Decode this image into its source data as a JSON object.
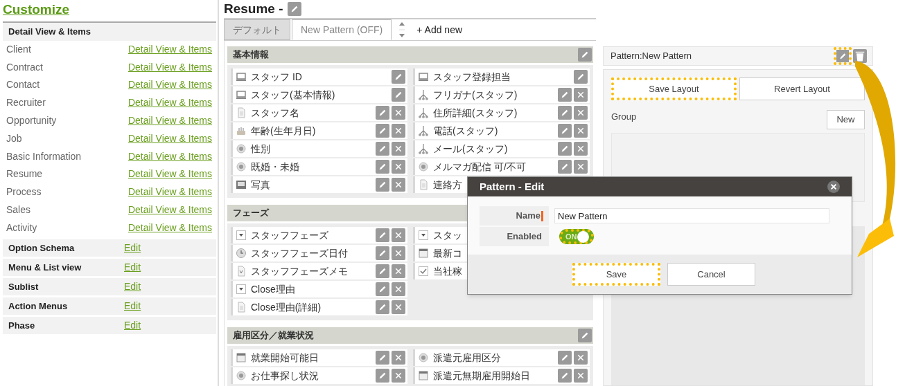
{
  "sidebar": {
    "title": "Customize",
    "header": "Detail View & Items",
    "items": [
      {
        "label": "Client",
        "link": "Detail View & Items"
      },
      {
        "label": "Contract",
        "link": "Detail View & Items"
      },
      {
        "label": "Contact",
        "link": "Detail View & Items"
      },
      {
        "label": "Recruiter",
        "link": "Detail View & Items"
      },
      {
        "label": "Opportunity",
        "link": "Detail View & Items"
      },
      {
        "label": "Job",
        "link": "Detail View & Items"
      },
      {
        "label": "Basic Information",
        "link": "Detail View & Items"
      },
      {
        "label": "Resume",
        "link": "Detail View & Items"
      },
      {
        "label": "Process",
        "link": "Detail View & Items"
      },
      {
        "label": "Sales",
        "link": "Detail View & Items"
      },
      {
        "label": "Activity",
        "link": "Detail View & Items"
      }
    ],
    "sections": [
      {
        "label": "Option Schema",
        "link": "Edit"
      },
      {
        "label": "Menu & List view",
        "link": "Edit"
      },
      {
        "label": "Sublist",
        "link": "Edit"
      },
      {
        "label": "Action Menus",
        "link": "Edit"
      },
      {
        "label": "Phase",
        "link": "Edit"
      }
    ]
  },
  "page": {
    "title": "Resume -"
  },
  "tabs": [
    {
      "label": "デフォルト",
      "selected": false
    },
    {
      "label": "New Pattern (OFF)",
      "selected": true
    }
  ],
  "add_new": "+ Add new",
  "sections": [
    {
      "title": "基本情報",
      "edit": true,
      "columns": [
        [
          {
            "kind": "monitor",
            "label": "スタッフ ID",
            "edit": true,
            "delete": false
          },
          {
            "kind": "monitor",
            "label": "スタッフ(基本情報)",
            "edit": true,
            "delete": false
          },
          {
            "kind": "doc",
            "label": "スタッフ名",
            "edit": true,
            "delete": true
          },
          {
            "kind": "cake",
            "label": "年齢(生年月日)",
            "edit": true,
            "delete": true
          },
          {
            "kind": "radio",
            "label": "性別",
            "edit": true,
            "delete": true
          },
          {
            "kind": "radio",
            "label": "既婚・未婚",
            "edit": true,
            "delete": true
          },
          {
            "kind": "photo",
            "label": "写真",
            "edit": true,
            "delete": true
          }
        ],
        [
          {
            "kind": "monitor",
            "label": "スタッフ登録担当",
            "edit": true,
            "delete": false
          },
          {
            "kind": "tree",
            "label": "フリガナ(スタッフ)",
            "edit": true,
            "delete": true
          },
          {
            "kind": "tree",
            "label": "住所詳細(スタッフ)",
            "edit": true,
            "delete": true
          },
          {
            "kind": "tree",
            "label": "電話(スタッフ)",
            "edit": true,
            "delete": true
          },
          {
            "kind": "tree",
            "label": "メール(スタッフ)",
            "edit": true,
            "delete": true
          },
          {
            "kind": "radio",
            "label": "メルマガ配信 可/不可",
            "edit": true,
            "delete": true
          },
          {
            "kind": "doc",
            "label": "連絡方",
            "edit": false,
            "delete": false
          }
        ]
      ]
    },
    {
      "title": "フェーズ",
      "edit": false,
      "columns": [
        [
          {
            "kind": "dropdown",
            "label": "スタッフフェーズ",
            "edit": true,
            "delete": true
          },
          {
            "kind": "clock",
            "label": "スタッフフェーズ日付",
            "edit": true,
            "delete": true
          },
          {
            "kind": "memo",
            "label": "スタッフフェーズメモ",
            "edit": true,
            "delete": true
          },
          {
            "kind": "dropdown",
            "label": "Close理由",
            "edit": true,
            "delete": true
          },
          {
            "kind": "doc",
            "label": "Close理由(詳細)",
            "edit": true,
            "delete": true
          }
        ],
        [
          {
            "kind": "dropdown",
            "label": "スタッ",
            "edit": false,
            "delete": false
          },
          {
            "kind": "calendar",
            "label": "最新コ",
            "edit": false,
            "delete": false
          },
          {
            "kind": "check",
            "label": "当社稼",
            "edit": false,
            "delete": false
          }
        ]
      ]
    },
    {
      "title": "雇用区分／就業状況",
      "edit": true,
      "columns": [
        [
          {
            "kind": "calendar",
            "label": "就業開始可能日",
            "edit": true,
            "delete": true
          },
          {
            "kind": "radio",
            "label": "お仕事探し状況",
            "edit": true,
            "delete": true
          }
        ],
        [
          {
            "kind": "radio",
            "label": "派遣元雇用区分",
            "edit": true,
            "delete": true
          },
          {
            "kind": "calendar",
            "label": "派遣元無期雇用開始日",
            "edit": true,
            "delete": true
          }
        ]
      ]
    }
  ],
  "pattern_panel": {
    "title": "Pattern:New Pattern",
    "edit_highlighted": true,
    "buttons": [
      {
        "label": "Save Layout",
        "highlighted": true
      },
      {
        "label": "Revert Layout",
        "highlighted": false
      }
    ],
    "group_label": "Group",
    "new_button": "New"
  },
  "dialog": {
    "title": "Pattern - Edit",
    "name_label": "Name",
    "name_value": "New Pattern",
    "enabled_label": "Enabled",
    "enabled": true,
    "toggle_label": "ON",
    "toggle_highlighted": true,
    "buttons": [
      {
        "label": "Save",
        "highlighted": true
      },
      {
        "label": "Cancel",
        "highlighted": false
      }
    ]
  }
}
